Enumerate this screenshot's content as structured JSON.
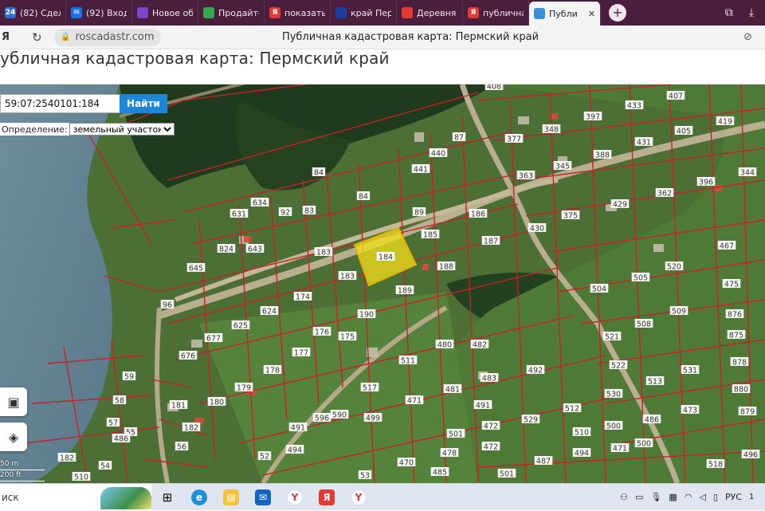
{
  "browser": {
    "tabs": [
      {
        "title": "(82) Сдел",
        "fav_text": "24",
        "fav_color": "#2a6fd6"
      },
      {
        "title": "(92) Входя",
        "fav_text": "✉",
        "fav_color": "#1a73e8"
      },
      {
        "title": "Новое об",
        "fav_text": "",
        "fav_color": "#7b46c7"
      },
      {
        "title": "Продайте",
        "fav_text": "",
        "fav_color": "#34a853"
      },
      {
        "title": "показать",
        "fav_text": "Я",
        "fav_color": "#e53935"
      },
      {
        "title": "край Пер",
        "fav_text": "",
        "fav_color": "#1c3f9e"
      },
      {
        "title": "Деревня",
        "fav_text": "",
        "fav_color": "#e53935"
      },
      {
        "title": "публична",
        "fav_text": "Я",
        "fav_color": "#e53935"
      },
      {
        "title": "Публи",
        "fav_text": "",
        "fav_color": "#3a8fd9"
      }
    ],
    "active_tab_index": 8,
    "url": "roscadastr.com",
    "title_center": "Публичная кадастровая карта: Пермский край",
    "logo_text": "Я"
  },
  "page": {
    "heading": "убличная кадастровая карта: Пермский край"
  },
  "search": {
    "value": "59:07:2540101:184",
    "button_label": "Найти"
  },
  "definition": {
    "label": "Определение:",
    "selected": "земельный участок"
  },
  "scale": {
    "metric": "50 m",
    "imperial": "200 ft"
  },
  "selected_parcel": "184",
  "parcel_labels": [
    "408",
    "407",
    "433",
    "419",
    "397",
    "348",
    "377",
    "405",
    "87",
    "440",
    "441",
    "431",
    "388",
    "345",
    "363",
    "344",
    "84",
    "396",
    "362",
    "429",
    "84",
    "83",
    "89",
    "631",
    "634",
    "92",
    "186",
    "375",
    "430",
    "185",
    "187",
    "824",
    "643",
    "645",
    "183",
    "183",
    "184",
    "188",
    "467",
    "520",
    "189",
    "505",
    "504",
    "475",
    "174",
    "96",
    "190",
    "624",
    "509",
    "508",
    "876",
    "625",
    "875",
    "677",
    "676",
    "176",
    "175",
    "521",
    "480",
    "482",
    "177",
    "178",
    "522",
    "878",
    "511",
    "492",
    "531",
    "59",
    "179",
    "517",
    "483",
    "481",
    "471",
    "513",
    "180",
    "181",
    "530",
    "880",
    "58",
    "499",
    "596",
    "590",
    "473",
    "491",
    "512",
    "529",
    "57",
    "182",
    "55",
    "500",
    "486",
    "879",
    "510",
    "501",
    "472",
    "494",
    "491",
    "471",
    "500",
    "486",
    "56",
    "182",
    "52",
    "470",
    "485",
    "478",
    "472",
    "494",
    "501",
    "518",
    "496",
    "487",
    "510",
    "54",
    "53",
    "493"
  ],
  "taskbar": {
    "search_text": "иск",
    "lang": "РУС",
    "clock": "1"
  },
  "colors": {
    "tab_strip": "#4a1f3d",
    "parcel_outline": "#c8202a",
    "selected_fill": "#f3e21a",
    "button_blue": "#1b87d6"
  }
}
